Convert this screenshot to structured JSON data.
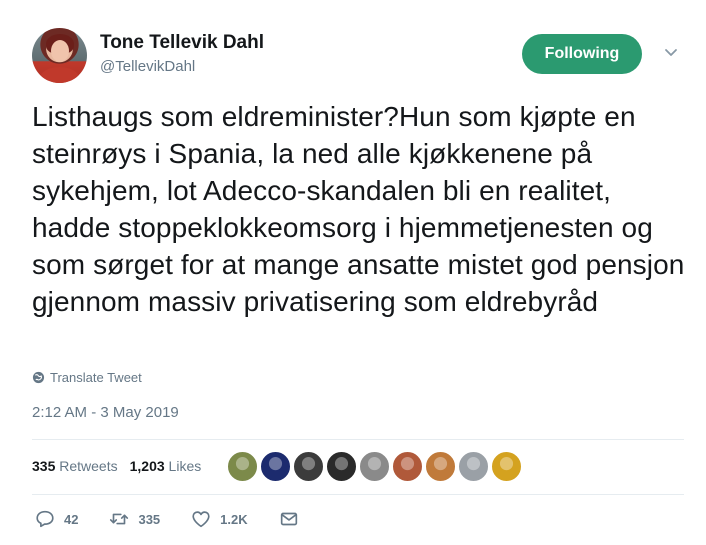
{
  "author": {
    "display_name": "Tone Tellevik Dahl",
    "handle": "@TellevikDahl"
  },
  "follow_button": {
    "label": "Following"
  },
  "tweet": {
    "text": "Listhaugs som eldreminister?Hun som kjøpte en steinrøys i Spania, la ned alle kjøkkenene på sykehjem, lot Adecco-skandalen bli en realitet, hadde stoppeklokkeomsorg i hjemmetjenesten og som sørget for at mange ansatte mistet god pensjon gjennom massiv privatisering som eldrebyråd",
    "translate_label": "Translate Tweet",
    "timestamp": "2:12 AM - 3 May 2019"
  },
  "stats": {
    "retweets_count": "335",
    "retweets_label": "Retweets",
    "likes_count": "1,203",
    "likes_label": "Likes"
  },
  "likers": [
    {
      "color": "#7c8a4a"
    },
    {
      "color": "#1c2b6e"
    },
    {
      "color": "#3b3b3b"
    },
    {
      "color": "#2a2a2a"
    },
    {
      "color": "#8a8a8a"
    },
    {
      "color": "#b0593a"
    },
    {
      "color": "#c07a3a"
    },
    {
      "color": "#9aa0a6"
    },
    {
      "color": "#d4a21f"
    }
  ],
  "actions": {
    "reply_count": "42",
    "retweet_count": "335",
    "like_count": "1.2K"
  },
  "icons": {
    "reply": "reply-icon",
    "retweet": "retweet-icon",
    "like": "heart-icon",
    "message": "envelope-icon",
    "translate": "globe-icon",
    "menu": "chevron-down-icon"
  },
  "colors": {
    "follow_button": "#2b9a70",
    "secondary_text": "#657786"
  }
}
